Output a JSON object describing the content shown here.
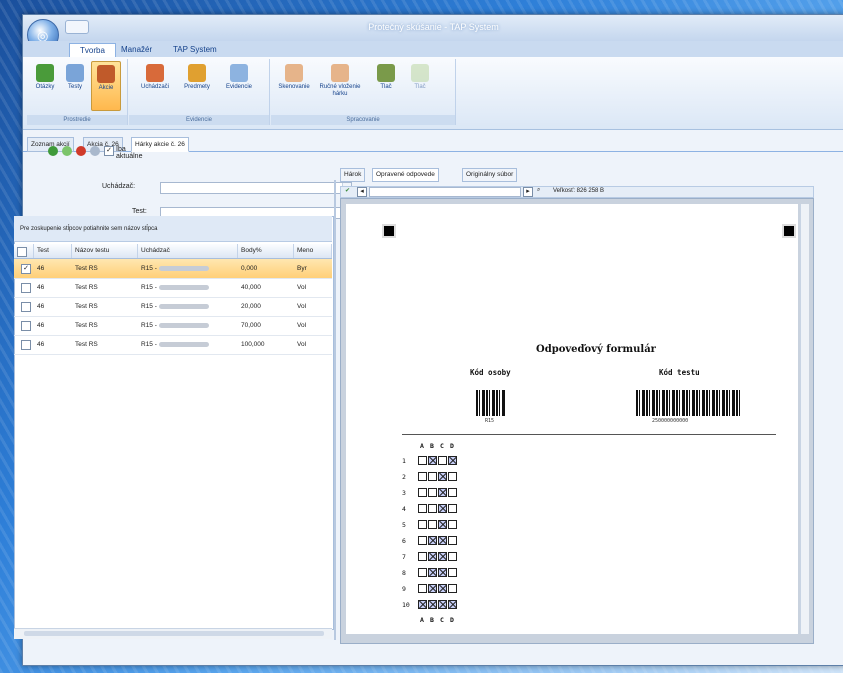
{
  "window": {
    "title": "Protečný skúšanie - TAP System"
  },
  "ribbon_tabs": [
    "Tvorba",
    "Manažér",
    "TAP System"
  ],
  "ribbon_groups": [
    {
      "caption": "Prostredie",
      "buttons": [
        "Otázky",
        "Testy",
        "Akcie"
      ]
    },
    {
      "caption": "Evidencie",
      "buttons": [
        "Uchádzači",
        "Predmety",
        "Evidencie"
      ]
    },
    {
      "caption": "Spracovanie",
      "buttons": [
        "Skenovanie",
        "Ručné vloženie hárku",
        "Tlač",
        "Tlač"
      ]
    }
  ],
  "doc_tabs": [
    "Zoznam akcií",
    "Akcia č. 26",
    "Hárky akcie č. 26"
  ],
  "toolbar": {
    "only_current_label": "Iba aktuálne",
    "only_current_checked": true
  },
  "filters": {
    "applicant_label": "Uchádzač:",
    "test_label": "Test:",
    "applicant_value": "",
    "test_value": ""
  },
  "grid": {
    "group_hint": "Pre zoskupenie stĺpcov potiahnite sem názov stĺpca",
    "columns": [
      "Test",
      "Názov testu",
      "Uchádzač",
      "Body%",
      "Meno"
    ],
    "rows": [
      {
        "checked": true,
        "test": "46",
        "name": "Test RS",
        "applicant": "R15 -",
        "points": "0,000",
        "note": "Byr",
        "selected": true
      },
      {
        "checked": false,
        "test": "46",
        "name": "Test RS",
        "applicant": "R15 -",
        "points": "40,000",
        "note": "Vol",
        "selected": false
      },
      {
        "checked": false,
        "test": "46",
        "name": "Test RS",
        "applicant": "R15 -",
        "points": "20,000",
        "note": "Vol",
        "selected": false
      },
      {
        "checked": false,
        "test": "46",
        "name": "Test RS",
        "applicant": "R15 -",
        "points": "70,000",
        "note": "Vol",
        "selected": false
      },
      {
        "checked": false,
        "test": "46",
        "name": "Test RS",
        "applicant": "R15 -",
        "points": "100,000",
        "note": "Vol",
        "selected": false
      }
    ]
  },
  "preview_tabs": [
    "Hárok",
    "Opravené odpovede",
    "Originálny súbor"
  ],
  "preview_nav": {
    "size_label": "Veľkosť: 826 258 B"
  },
  "form": {
    "title": "Odpoveďový formulár",
    "person_code_label": "Kód osoby",
    "test_code_label": "Kód testu",
    "person_code_value": "R15",
    "test_code_value": "250000000000",
    "column_headers": [
      "A",
      "B",
      "C",
      "D"
    ],
    "answers": [
      {
        "q": "1",
        "marks": [
          false,
          true,
          false,
          true
        ]
      },
      {
        "q": "2",
        "marks": [
          false,
          false,
          true,
          false
        ]
      },
      {
        "q": "3",
        "marks": [
          false,
          false,
          true,
          false
        ]
      },
      {
        "q": "4",
        "marks": [
          false,
          false,
          true,
          false
        ]
      },
      {
        "q": "5",
        "marks": [
          false,
          false,
          true,
          false
        ]
      },
      {
        "q": "6",
        "marks": [
          false,
          true,
          true,
          false
        ]
      },
      {
        "q": "7",
        "marks": [
          false,
          true,
          true,
          false
        ]
      },
      {
        "q": "8",
        "marks": [
          false,
          true,
          true,
          false
        ]
      },
      {
        "q": "9",
        "marks": [
          false,
          true,
          true,
          false
        ]
      },
      {
        "q": "10",
        "marks": [
          true,
          true,
          true,
          true
        ]
      }
    ]
  },
  "colors": {
    "accent": "#15428b",
    "selected_row": "#ffcf78",
    "checked_box": "#c6cef8"
  }
}
